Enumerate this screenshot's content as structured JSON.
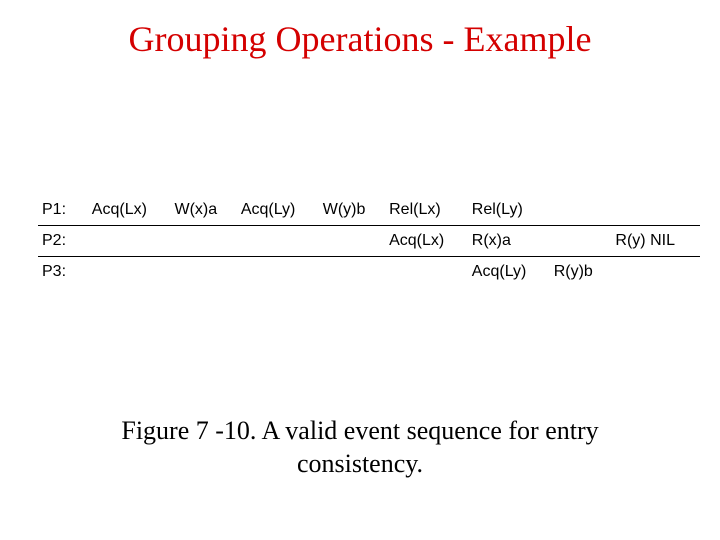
{
  "title": "Grouping Operations - Example",
  "rows": {
    "r0": {
      "proc": "P1:",
      "c0": "Acq(Lx)",
      "c1": "W(x)a",
      "c2": "Acq(Ly)",
      "c3": "W(y)b",
      "c4": "Rel(Lx)",
      "c5": "Rel(Ly)",
      "c6": "",
      "c7": ""
    },
    "r1": {
      "proc": "P2:",
      "c0": "",
      "c1": "",
      "c2": "",
      "c3": "",
      "c4": "Acq(Lx)",
      "c5": "R(x)a",
      "c6": "",
      "c7": "R(y) NIL"
    },
    "r2": {
      "proc": "P3:",
      "c0": "",
      "c1": "",
      "c2": "",
      "c3": "",
      "c4": "",
      "c5": "Acq(Ly)",
      "c6": "R(y)b",
      "c7": ""
    }
  },
  "caption": "Figure 7 -10. A valid event sequence for entry consistency."
}
